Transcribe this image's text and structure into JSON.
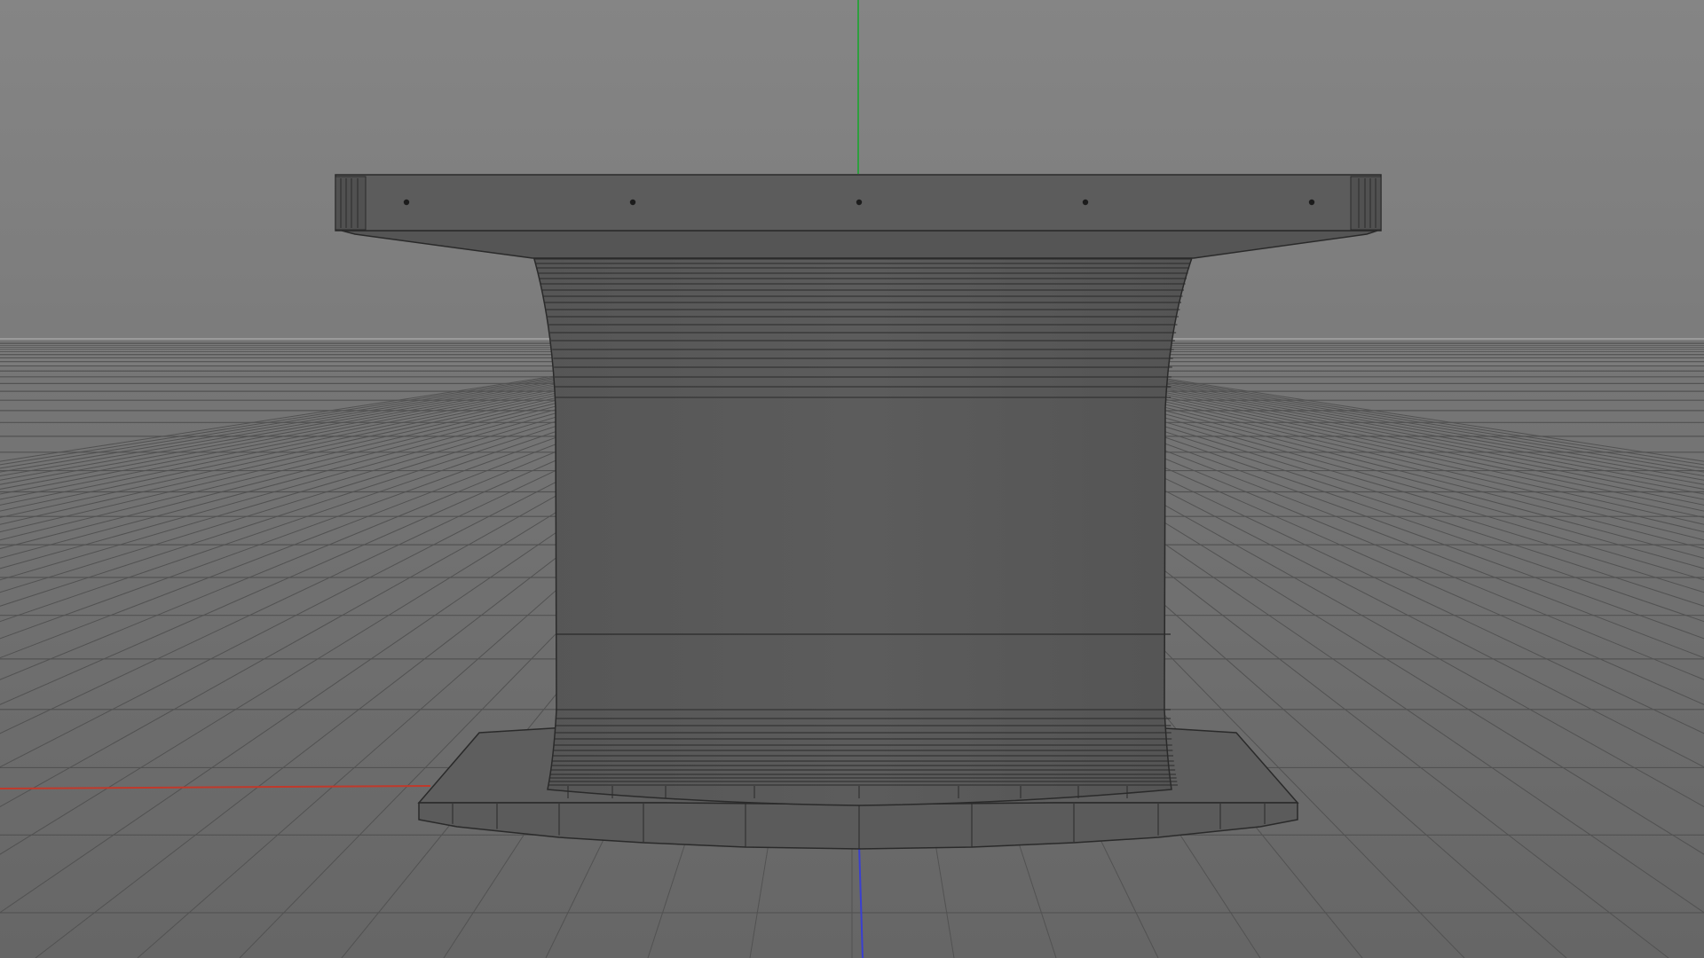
{
  "viewport": {
    "colors": {
      "background_top": "#848484",
      "background_horizon": "#777777",
      "floor_near": "#6a6a6a",
      "grid_line": "#525252",
      "axis_x": "#c0392b",
      "axis_y": "#2e9e3e",
      "axis_z": "#3a3fd0",
      "model_face": "#5a5a5a",
      "model_face_light": "#646464",
      "model_wire": "#2a2a2a"
    },
    "model": {
      "name_icon": "table-mesh-icon",
      "top_bolt_count": 5
    }
  }
}
